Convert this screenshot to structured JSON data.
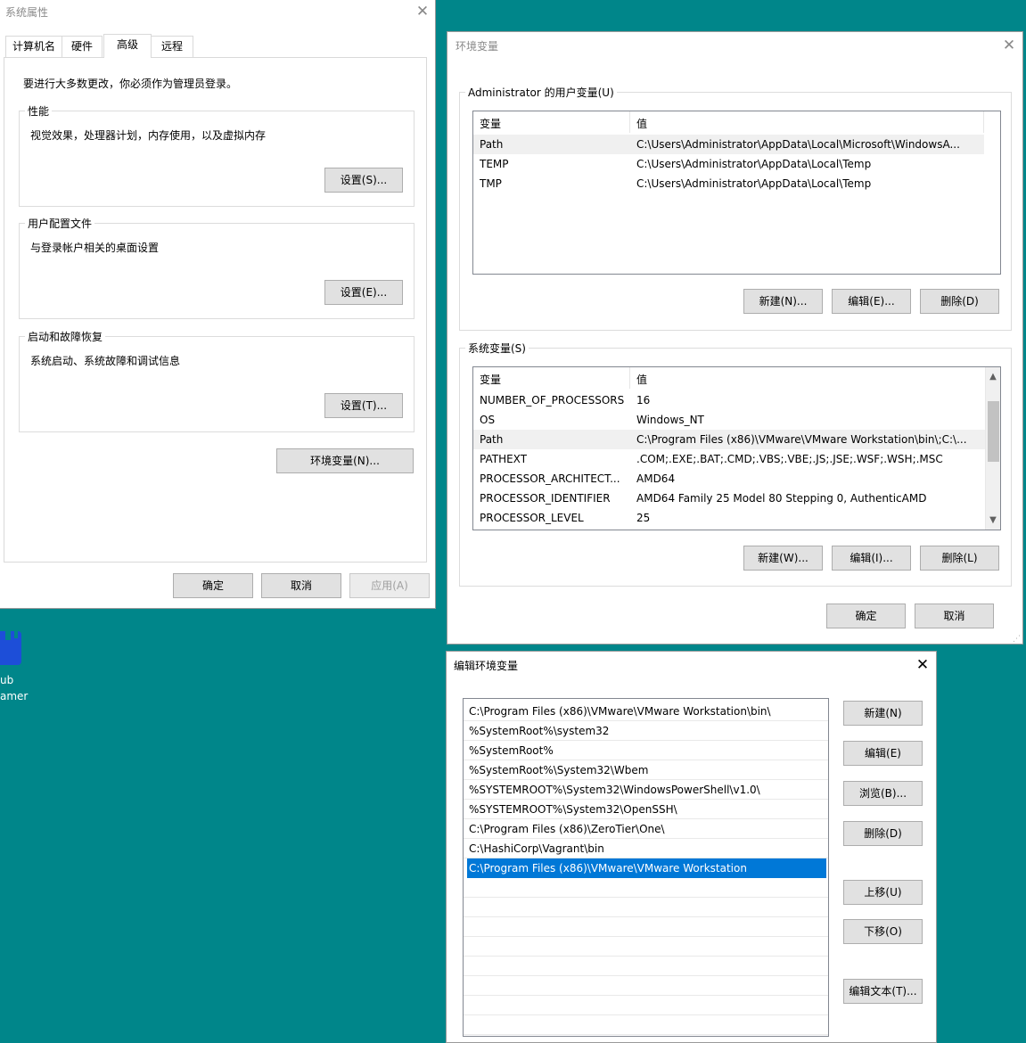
{
  "desktop": {
    "icon_label_line1": "ub",
    "icon_label_line2": "amer",
    "partial_label": "a",
    "icon_color": "#1d4ed8"
  },
  "system_properties": {
    "title": "系统属性",
    "tabs": [
      "计算机名",
      "硬件",
      "高级",
      "远程"
    ],
    "selected_tab": "高级",
    "admin_note": "要进行大多数更改，你必须作为管理员登录。",
    "performance": {
      "label": "性能",
      "description": "视觉效果，处理器计划，内存使用，以及虚拟内存",
      "button": "设置(S)..."
    },
    "user_profiles": {
      "label": "用户配置文件",
      "description": "与登录帐户相关的桌面设置",
      "button": "设置(E)..."
    },
    "startup_recovery": {
      "label": "启动和故障恢复",
      "description": "系统启动、系统故障和调试信息",
      "button": "设置(T)..."
    },
    "env_vars_button": "环境变量(N)...",
    "ok": "确定",
    "cancel": "取消",
    "apply": "应用(A)"
  },
  "environment_variables": {
    "title": "环境变量",
    "user_group_label": "Administrator 的用户变量(U)",
    "user_columns": [
      "变量",
      "值"
    ],
    "user_vars": [
      {
        "name": "Path",
        "value": "C:\\Users\\Administrator\\AppData\\Local\\Microsoft\\WindowsA..."
      },
      {
        "name": "TEMP",
        "value": "C:\\Users\\Administrator\\AppData\\Local\\Temp"
      },
      {
        "name": "TMP",
        "value": "C:\\Users\\Administrator\\AppData\\Local\\Temp"
      }
    ],
    "user_buttons": {
      "new": "新建(N)...",
      "edit": "编辑(E)...",
      "delete": "删除(D)"
    },
    "system_group_label": "系统变量(S)",
    "system_columns": [
      "变量",
      "值"
    ],
    "system_vars": [
      {
        "name": "NUMBER_OF_PROCESSORS",
        "value": "16"
      },
      {
        "name": "OS",
        "value": "Windows_NT"
      },
      {
        "name": "Path",
        "value": "C:\\Program Files (x86)\\VMware\\VMware Workstation\\bin\\;C:\\..."
      },
      {
        "name": "PATHEXT",
        "value": ".COM;.EXE;.BAT;.CMD;.VBS;.VBE;.JS;.JSE;.WSF;.WSH;.MSC"
      },
      {
        "name": "PROCESSOR_ARCHITECT...",
        "value": "AMD64"
      },
      {
        "name": "PROCESSOR_IDENTIFIER",
        "value": "AMD64 Family 25 Model 80 Stepping 0, AuthenticAMD"
      },
      {
        "name": "PROCESSOR_LEVEL",
        "value": "25"
      }
    ],
    "system_buttons": {
      "new": "新建(W)...",
      "edit": "编辑(I)...",
      "delete": "删除(L)"
    },
    "ok": "确定",
    "cancel": "取消"
  },
  "edit_env_var": {
    "title": "编辑环境变量",
    "entries": [
      "C:\\Program Files (x86)\\VMware\\VMware Workstation\\bin\\",
      "%SystemRoot%\\system32",
      "%SystemRoot%",
      "%SystemRoot%\\System32\\Wbem",
      "%SYSTEMROOT%\\System32\\WindowsPowerShell\\v1.0\\",
      "%SYSTEMROOT%\\System32\\OpenSSH\\",
      "C:\\Program Files (x86)\\ZeroTier\\One\\",
      "C:\\HashiCorp\\Vagrant\\bin",
      "C:\\Program Files (x86)\\VMware\\VMware Workstation"
    ],
    "selected_entry": "C:\\Program Files (x86)\\VMware\\VMware Workstation",
    "buttons": {
      "new": "新建(N)",
      "edit": "编辑(E)",
      "browse": "浏览(B)...",
      "delete": "删除(D)",
      "move_up": "上移(U)",
      "move_down": "下移(O)",
      "edit_text": "编辑文本(T)..."
    },
    "selection_color": "#0078d7"
  },
  "close_glyph": "✕"
}
